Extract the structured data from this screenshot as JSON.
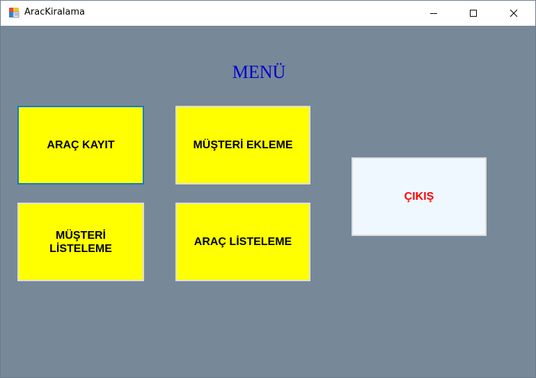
{
  "window": {
    "title": "AracKiralama",
    "icon": "form-app-icon",
    "controls": [
      "minimize-icon",
      "maximize-icon",
      "close-icon"
    ],
    "background_color": "#778899"
  },
  "menu": {
    "title": "MENÜ",
    "title_color": "#0000CD"
  },
  "buttons": {
    "arac_kayit": "ARAÇ KAYIT",
    "musteri_ekleme": "MÜŞTERİ EKLEME",
    "musteri_listeleme": "MÜŞTERİ\nLİSTELEME",
    "arac_listeleme": "ARAÇ LİSTELEME",
    "cikis": "ÇIKIŞ"
  },
  "colors": {
    "tile_yellow": "#FFFF00",
    "exit_tile": "#F0F8FF",
    "exit_text": "#FF0000",
    "focus_border": "#0A78D7"
  }
}
